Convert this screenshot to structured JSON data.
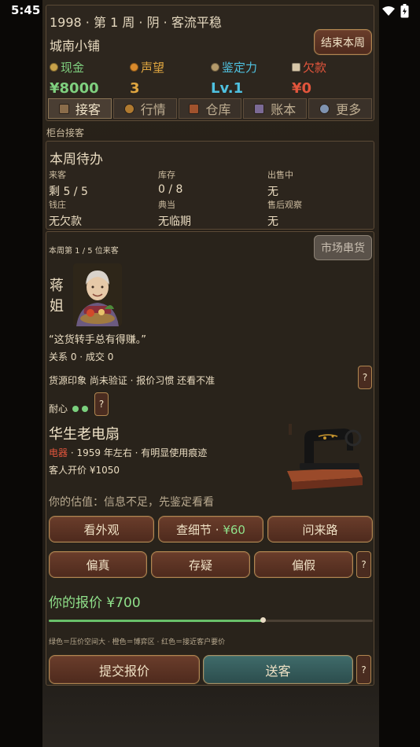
{
  "status_bar": {
    "time": "5:45"
  },
  "header": {
    "info_line": "1998 · 第 1 周 · 阴 · 客流平稳",
    "shop_name": "城南小铺",
    "end_week_label": "结束本周",
    "stats": [
      {
        "label": "现金",
        "value": "¥8000",
        "color": "#7fd07f"
      },
      {
        "label": "声望",
        "value": "3",
        "color": "#e0a640"
      },
      {
        "label": "鉴定力",
        "value": "Lv.1",
        "color": "#4fc1e0"
      },
      {
        "label": "欠款",
        "value": "¥0",
        "color": "#e2553c"
      }
    ],
    "tabs": [
      "接客",
      "行情",
      "仓库",
      "账本",
      "更多"
    ]
  },
  "section_label": "柜台接客",
  "todo": {
    "title": "本周待办",
    "cells": [
      {
        "k": "来客",
        "v": "剩 5 / 5"
      },
      {
        "k": "库存",
        "v": "0 / 8"
      },
      {
        "k": "出售中",
        "v": "无"
      },
      {
        "k": "钱庄",
        "v": "无欠款"
      },
      {
        "k": "典当",
        "v": "无临期"
      },
      {
        "k": "售后观察",
        "v": "无"
      }
    ]
  },
  "customer": {
    "counter": "本周第 1 / 5 位来客",
    "market_button": "市场串货",
    "name": "蒋姐",
    "quote": "“这货转手总有得赚。”",
    "relation": "关系 0 · 成交 0",
    "impression": "货源印象 尚未验证 · 报价习惯 还看不准",
    "patience_label": "耐心",
    "patience_dots": 2,
    "help": "?"
  },
  "item": {
    "name": "华生老电扇",
    "category": "电器",
    "desc_rest": " · 1959 年左右 · 有明显使用痕迹",
    "ask": "客人开价 ¥1050",
    "estimate": "你的估值：信息不足，先鉴定看看"
  },
  "actions": {
    "inspect": [
      "看外观",
      "查细节 · ¥60",
      "问来路"
    ],
    "inspect_price": "¥60",
    "judge": [
      "偏真",
      "存疑",
      "偏假"
    ]
  },
  "offer": {
    "label": "你的报价 ¥700",
    "slider_fraction": 0.66,
    "legend": "绿色＝压价空间大 · 橙色＝博弈区 · 红色＝接近客户要价"
  },
  "bottom": {
    "submit": "提交报价",
    "send_off": "送客"
  }
}
